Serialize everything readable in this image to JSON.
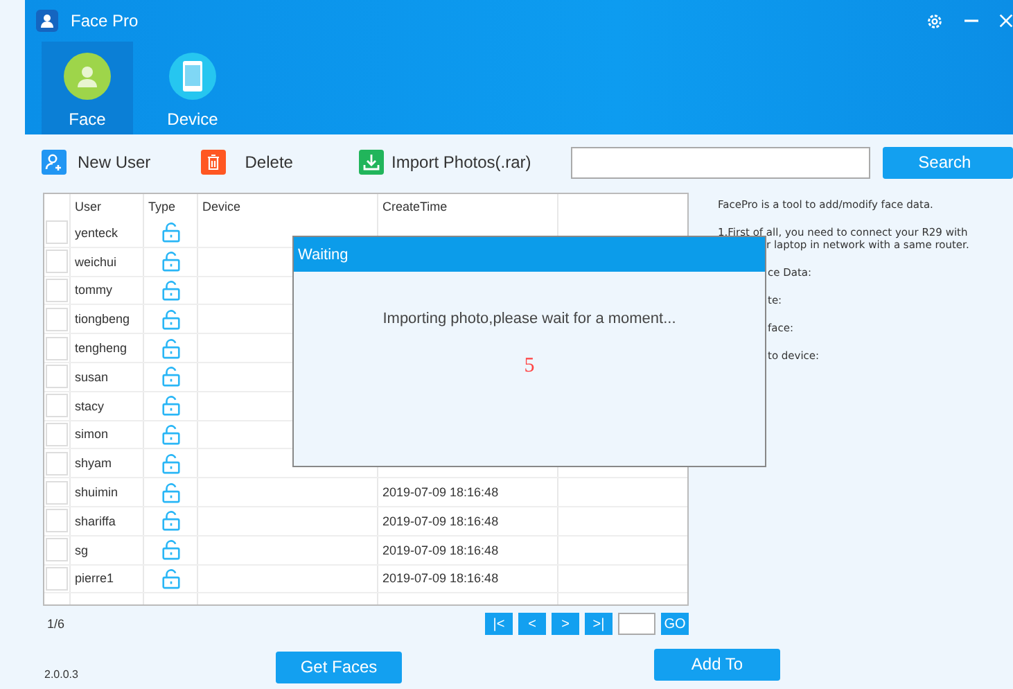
{
  "window": {
    "title": "Face Pro"
  },
  "nav_tabs": [
    {
      "label": "Face",
      "kind": "face",
      "selected": true
    },
    {
      "label": "Device",
      "kind": "device",
      "selected": false
    }
  ],
  "toolbar": [
    {
      "label": "New User",
      "kind": "add-user"
    },
    {
      "label": "Delete",
      "kind": "delete"
    },
    {
      "label": "Import Photos(.rar)",
      "kind": "import"
    }
  ],
  "search": {
    "button": "Search"
  },
  "table": {
    "columns": [
      "User",
      "Type",
      "Device",
      "CreateTime"
    ],
    "rows": [
      {
        "user": "yenteck",
        "checked": false
      },
      {
        "user": "weichui",
        "checked": false
      },
      {
        "user": "tommy",
        "checked": false
      },
      {
        "user": "tiongbeng",
        "checked": false
      },
      {
        "user": "tengheng",
        "checked": false
      },
      {
        "user": "susan",
        "checked": false
      },
      {
        "user": "stacy",
        "checked": false
      },
      {
        "user": "simon",
        "checked": false
      },
      {
        "user": "shyam",
        "checked": false
      },
      {
        "user": "shuimin",
        "checked": false,
        "create_time": "2019-07-09 18:16:48"
      },
      {
        "user": "shariffa",
        "checked": false,
        "create_time": "2019-07-09 18:16:48"
      },
      {
        "user": "sg",
        "checked": false,
        "create_time": "2019-07-09 18:16:48"
      },
      {
        "user": "pierre1",
        "checked": false,
        "create_time": "2019-07-09 18:16:48"
      }
    ]
  },
  "pagination": {
    "page": "1/6",
    "buttons": [
      "|<",
      "<",
      ">",
      ">|"
    ],
    "go": "GO"
  },
  "info_panel": {
    "intro": "FacePro is a tool to add/modify face data.",
    "step": "1.First of all, you need to connect your R29 with",
    "fragments": [
      "r laptop in network with a same router.",
      "ce Data:",
      "te:",
      "face:",
      "to device:"
    ]
  },
  "buttons": {
    "get_faces": "Get Faces",
    "add_to": "Add To"
  },
  "version": "2.0.0.3",
  "dialog": {
    "title": "Waiting",
    "message": "Importing photo,please wait for a moment...",
    "countdown": "5"
  }
}
